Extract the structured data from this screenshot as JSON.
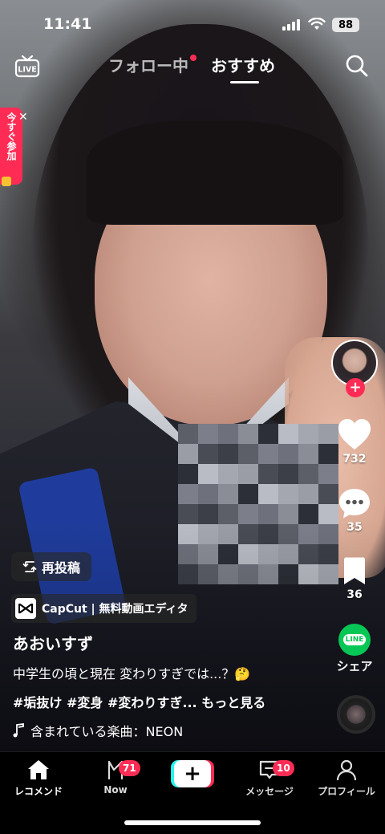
{
  "status_bar": {
    "time": "11:41",
    "battery": "88"
  },
  "top_nav": {
    "following_label": "フォロー中",
    "for_you_label": "おすすめ",
    "live_label": "LIVE"
  },
  "promo": {
    "join_label": "今すぐ参加"
  },
  "actions": {
    "likes": "732",
    "comments": "35",
    "saves": "36",
    "share_label": "シェア",
    "share_app": "LINE"
  },
  "post": {
    "repost_label": "再投稿",
    "capcut_label": "CapCut | 無料動画エディタ",
    "username": "あおいすず",
    "caption": "中学生の頃と現在 変わりすぎでは...？🤔",
    "hashtags": "#垢抜け #変身 #変わりすぎ...",
    "see_more": "もっと見る",
    "music": "含まれている楽曲：NEON"
  },
  "bottom_nav": {
    "home_label": "レコメンド",
    "now_label": "Now",
    "now_badge": "71",
    "inbox_label": "メッセージ",
    "inbox_badge": "10",
    "profile_label": "プロフィール"
  },
  "colors": {
    "accent": "#fe2c55",
    "cyan": "#25f4ee",
    "line_green": "#06c755"
  }
}
